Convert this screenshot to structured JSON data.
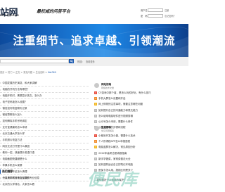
{
  "header": {
    "logo": "站网",
    "logo_sub": "ZHANWANG",
    "slogan": "最权威的问答平台",
    "login": {
      "username_label": "用户名：",
      "password_label": "密　码：",
      "forgot_link": "忘记密码？",
      "register_link": "注册"
    }
  },
  "banner": {
    "text": "注重细节、追求卓越、引领潮流"
  },
  "search": {
    "hot_label": "热搜：",
    "hot_link": "查看更多"
  },
  "breadcrumb": {
    "items": [
      "首页",
      "热门",
      "正文",
      "常见问题",
      "生活百科"
    ],
    "current": "Net369"
  },
  "left_list": [
    "：中国发展历史演变，和大家讲解",
    "，电脑的开机方法有哪些？",
    "：电脑开机时，黑屏显示英文，怎么办",
    "，电子密码锁怎么设置？",
    "：微信如何恢复聊天记录",
    "，微信群聊怎么加人",
    "，如何解除手机号码绑定",
    "：支付宝健康码怎么申请",
    "：北京交通大学怎么样",
    "，手机照片恢复方法",
    "：网页无法打开是什么原因",
    "：教你一招，快速提升英语口语",
    "：电脑截图快捷键是什么",
    "：苹果手机怎么录屏",
    "：手机内存不足怎么清理",
    "：怎么用手机查询社保缴费"
  ],
  "panels": [
    {
      "title": "网站前端",
      "subtitle": "网络技术文章",
      "items": [
        {
          "num": "1",
          "text": "CF游戏中那个蓝，是怎么玩的好玩，有什么技巧"
        },
        {
          "num": "2",
          "text": "手机大屏怎么设置和开启"
        },
        {
          "num": "3",
          "text": "网上购物的注意事项，需要注意哪些问题"
        },
        {
          "num": "4",
          "text": "如何提升自己的沟通能力和表达能力"
        },
        {
          "num": "5",
          "text": "怎么使用电脑软件进行视频剪辑"
        },
        {
          "num": "6",
          "text": "公众号怎么申请，需要什么条件"
        },
        {
          "num": "7",
          "text": "公积金提取的步骤和流程"
        }
      ]
    },
    {
      "title": "生活百科",
      "subtitle": "常见问题解答",
      "items": [
        {
          "num": "1",
          "text": "小程序开发怎么做，需要什么技术"
        },
        {
          "num": "2",
          "text": "个人所得税APP怎么申报退税"
        },
        {
          "num": "3",
          "text": "电脑蓝屏怎么解决，常见原因分析"
        },
        {
          "num": "4",
          "text": "2022年高考志愿填报指南"
        },
        {
          "num": "5",
          "text": "新手学做菜，家常菜做法大全"
        },
        {
          "num": "6",
          "text": "如何选购适合自己的笔记本电脑"
        },
        {
          "num": "7",
          "text": "医保卡怎么用，报销比例是多少"
        }
      ]
    }
  ],
  "bottom": {
    "heading": "热门推荐",
    "items": [
      "，一直来同学对社会互联的专业信息",
      "：北京的大学排名，大家怎么看"
    ],
    "right_text": "，如何做好个人信息的保护？"
  },
  "watermark": "便民库"
}
